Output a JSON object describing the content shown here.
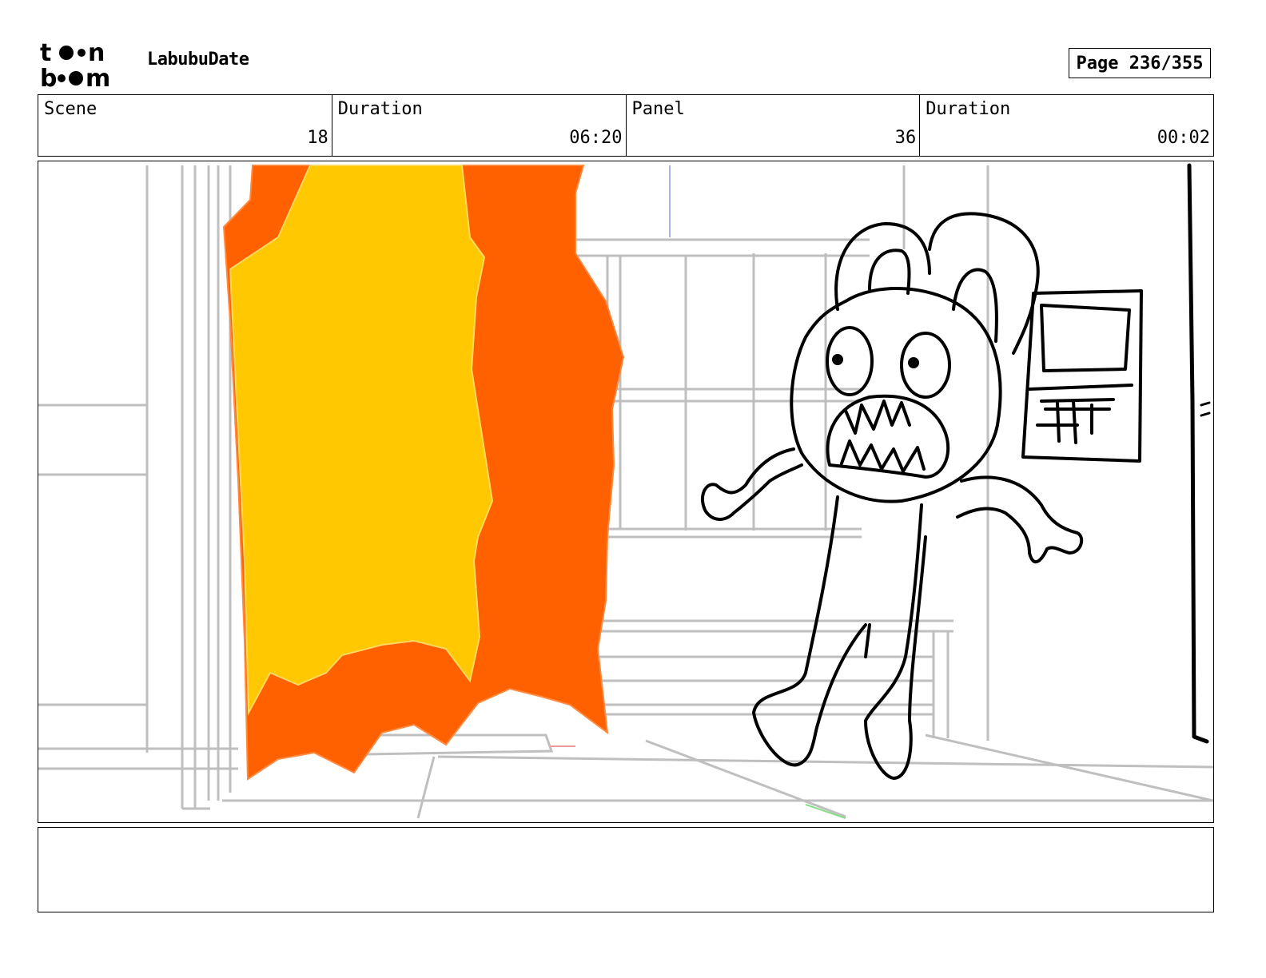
{
  "header": {
    "logo_text": "toon boom",
    "project_title": "LabubuDate",
    "page_label": "Page 236/355"
  },
  "info": {
    "scene_label": "Scene",
    "scene_value": "18",
    "scene_duration_label": "Duration",
    "scene_duration_value": "06:20",
    "panel_label": "Panel",
    "panel_value": "36",
    "panel_duration_label": "Duration",
    "panel_duration_value": "00:02"
  },
  "caption": {
    "text": ""
  },
  "colors": {
    "curtain_orange": "#ff6000",
    "curtain_yellow": "#ffc800",
    "sketch_gray": "#bfbfbf",
    "ink": "#000000"
  }
}
